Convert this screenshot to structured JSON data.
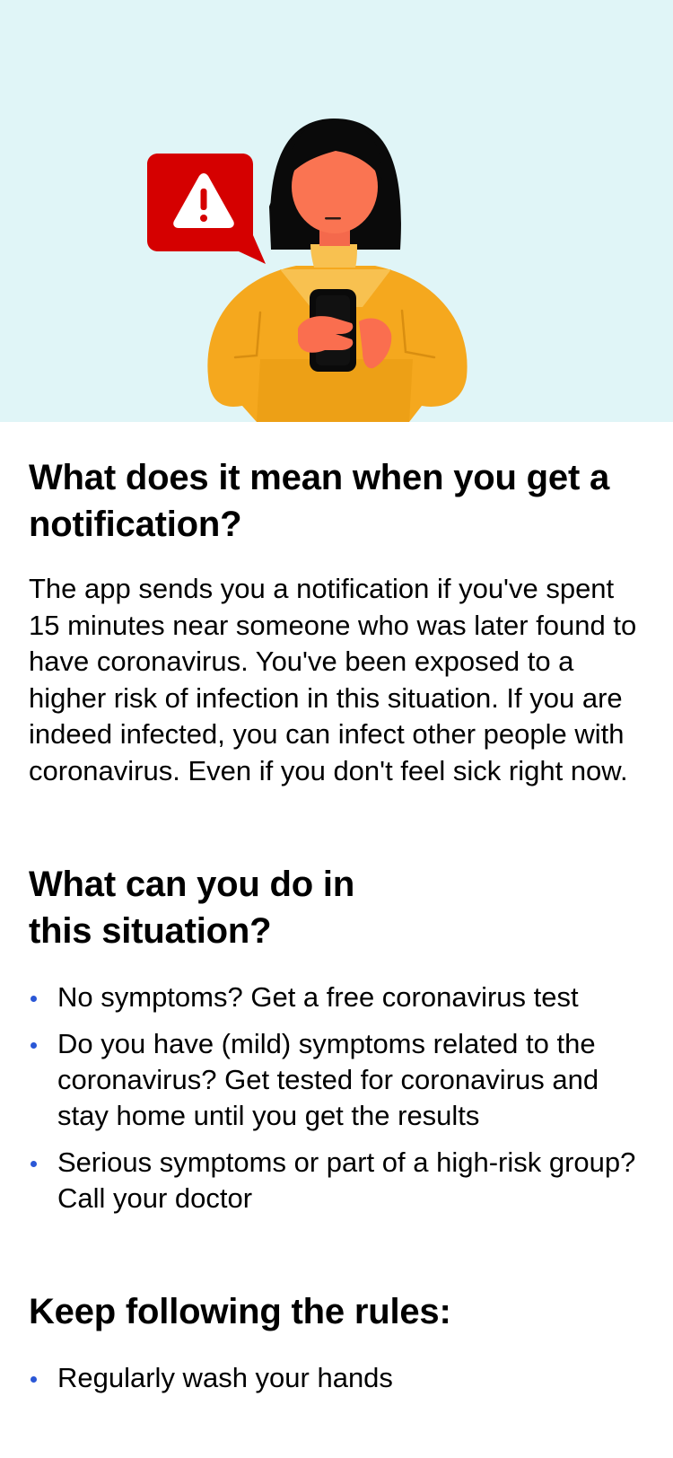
{
  "hero": {
    "illustration": "person-reading-phone-with-warning-icon",
    "colors": {
      "background": "#e0f5f7",
      "warning": "#d50000",
      "sweater": "#f5a623"
    }
  },
  "section1": {
    "title": "What does it mean when you get a notification?",
    "body": "The app sends you a notification if you've spent 15 minutes near someone who was later found to have coronavirus. You've been exposed to a higher risk of infection in this situation. If you are indeed infected, you can infect other people with coronavirus. Even if you don't feel sick right now."
  },
  "section2": {
    "title": "What can you do in this situation?",
    "bullets": [
      "No symptoms? Get a free coronavirus test",
      "Do you have (mild) symptoms related to the coronavirus? Get tested for coronavirus and stay home until you get the results",
      "Serious symptoms or part of a high-risk group? Call your doctor"
    ]
  },
  "section3": {
    "title": "Keep following the rules:",
    "bullets": [
      "Regularly wash your hands"
    ]
  },
  "accent_color": "#2a57d6"
}
